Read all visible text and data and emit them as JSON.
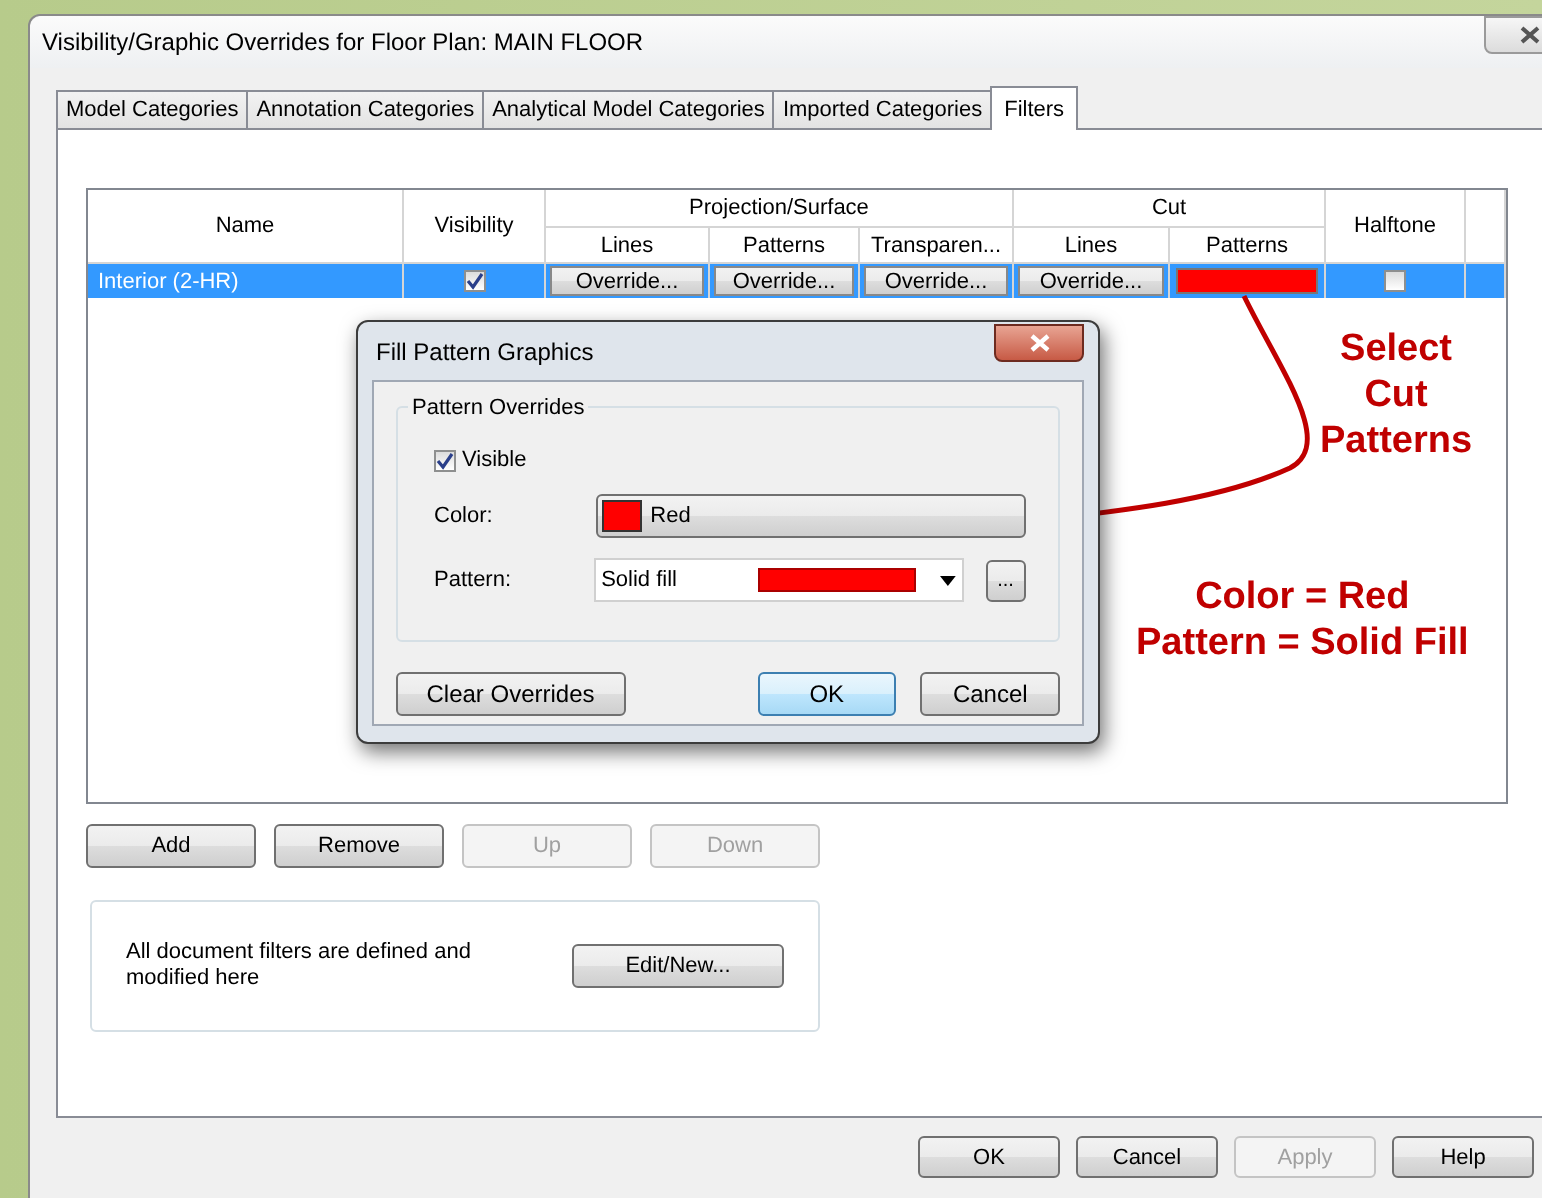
{
  "window": {
    "title": "Visibility/Graphic Overrides for Floor Plan: MAIN FLOOR",
    "tabs": [
      {
        "label": "Model Categories",
        "selected": false
      },
      {
        "label": "Annotation Categories",
        "selected": false
      },
      {
        "label": "Analytical Model Categories",
        "selected": false
      },
      {
        "label": "Imported Categories",
        "selected": false
      },
      {
        "label": "Filters",
        "selected": true
      }
    ],
    "table": {
      "header_groups": [
        {
          "label": "Name"
        },
        {
          "label": "Visibility"
        },
        {
          "label": "Projection/Surface",
          "columns": [
            "Lines",
            "Patterns",
            "Transparen..."
          ]
        },
        {
          "label": "Cut",
          "columns": [
            "Lines",
            "Patterns"
          ]
        },
        {
          "label": "Halftone"
        }
      ],
      "rows": [
        {
          "name": "Interior (2-HR)",
          "selected": true,
          "visible": true,
          "halftone": false,
          "overrides": [
            {
              "kind": "button",
              "label": "Override..."
            },
            {
              "kind": "button",
              "label": "Override..."
            },
            {
              "kind": "button",
              "label": "Override..."
            },
            {
              "kind": "button",
              "label": "Override..."
            },
            {
              "kind": "swatch",
              "color": "#ff0000"
            }
          ]
        }
      ]
    },
    "row_buttons": [
      {
        "label": "Add",
        "disabled": false
      },
      {
        "label": "Remove",
        "disabled": false
      },
      {
        "label": "Up",
        "disabled": true
      },
      {
        "label": "Down",
        "disabled": true
      }
    ],
    "filters_note": {
      "text": "All document filters are defined and modified here",
      "button": "Edit/New..."
    },
    "footer_buttons": [
      {
        "label": "OK",
        "disabled": false
      },
      {
        "label": "Cancel",
        "disabled": false
      },
      {
        "label": "Apply",
        "disabled": true
      },
      {
        "label": "Help",
        "disabled": false
      }
    ]
  },
  "dialog": {
    "title": "Fill Pattern Graphics",
    "group": "Pattern Overrides",
    "visible": {
      "label": "Visible",
      "checked": true
    },
    "color": {
      "label": "Color:",
      "value": "Red",
      "color": "#ff0000"
    },
    "pattern": {
      "label": "Pattern:",
      "value": "Solid fill",
      "color": "#ff0000",
      "more": "..."
    },
    "buttons": [
      {
        "label": "Clear Overrides",
        "default": false
      },
      {
        "label": "OK",
        "default": true
      },
      {
        "label": "Cancel",
        "default": false
      }
    ]
  },
  "annotations": [
    {
      "lines": [
        "Select",
        "Cut",
        "Patterns"
      ]
    },
    {
      "lines": [
        "Color = Red",
        "Pattern = Solid Fill"
      ]
    }
  ]
}
